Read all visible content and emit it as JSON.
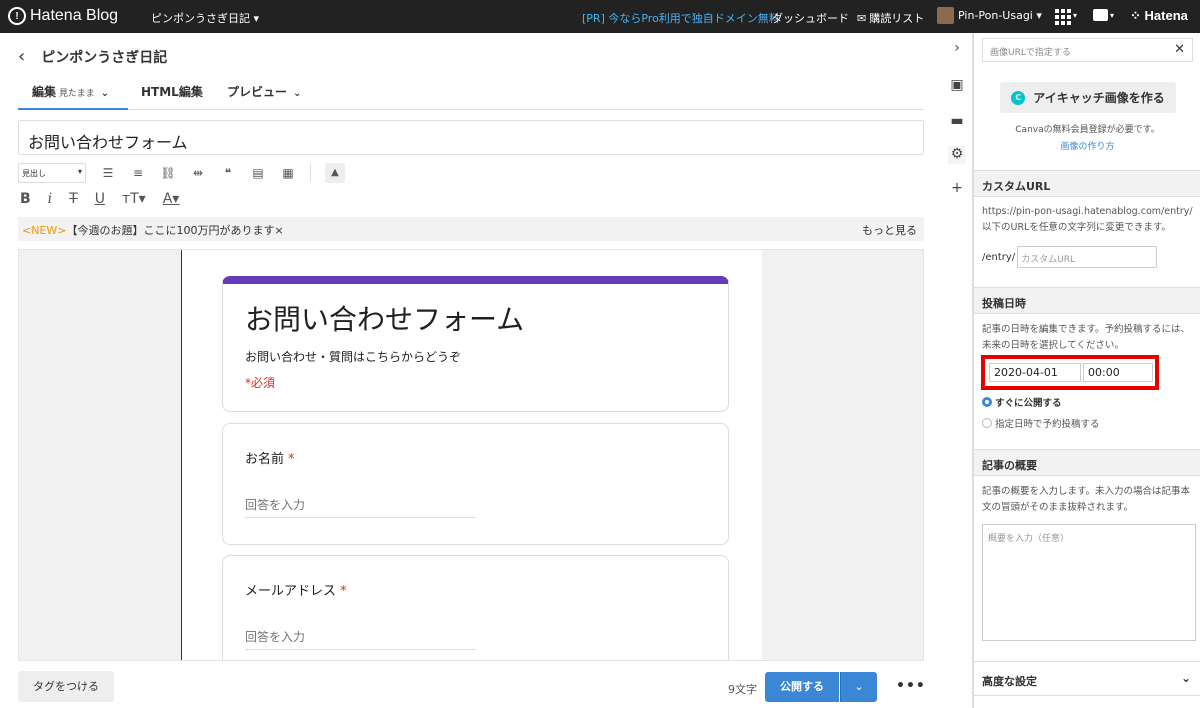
{
  "topbar": {
    "logo": "Hatena Blog",
    "blog_selector": "ピンポンうさぎ日記 ▾",
    "promo": "[PR] 今ならPro利用で独自ドメイン無料",
    "dashboard": "ダッシュボード",
    "subscriptions": "購読リスト",
    "user": "Pin-Pon-Usagi ▾",
    "hatena": "Hatena"
  },
  "editor": {
    "blog_title": "ピンポンうさぎ日記",
    "tabs": {
      "edit": "編集",
      "edit_mode": "見たまま",
      "html": "HTML編集",
      "preview": "プレビュー"
    },
    "entry_title": "お問い合わせフォーム",
    "format_select": "見出し",
    "new_banner": {
      "badge": "<NEW>",
      "text": "【今週のお題】ここに100万円があります",
      "close": "×",
      "more": "もっと見る"
    }
  },
  "form": {
    "title": "お問い合わせフォーム",
    "description": "お問い合わせ・質問はこちらからどうぞ",
    "required_note": "*必須",
    "questions": [
      {
        "label": "お名前",
        "star": "*",
        "placeholder": "回答を入力"
      },
      {
        "label": "メールアドレス",
        "star": "*",
        "placeholder": "回答を入力"
      }
    ]
  },
  "footer": {
    "tag_button": "タグをつける",
    "char_count": "9文字",
    "publish": "公開する",
    "more": "•••"
  },
  "panel": {
    "image_url_placeholder": "画像URLで指定する",
    "canva_button": "アイキャッチ画像を作る",
    "canva_note": "Canvaの無料会員登録が必要です。",
    "canva_link": "画像の作り方",
    "custom_url": {
      "heading": "カスタムURL",
      "desc": "https://pin-pon-usagi.hatenablog.com/entry/以下のURLを任意の文字列に変更できます。",
      "prefix": "/entry/",
      "placeholder": "カスタムURL"
    },
    "post_date": {
      "heading": "投稿日時",
      "desc": "記事の日時を編集できます。予約投稿するには、未来の日時を選択してください。",
      "date": "2020-04-01",
      "time": "00:00",
      "option_now": "すぐに公開する",
      "option_schedule": "指定日時で予約投稿する"
    },
    "summary": {
      "heading": "記事の概要",
      "desc": "記事の概要を入力します。未入力の場合は記事本文の冒頭がそのまま抜粋されます。",
      "placeholder": "概要を入力（任意）"
    },
    "advanced": "高度な設定"
  },
  "colors": {
    "topbar": "#222222",
    "accent": "#3b87d6",
    "form_header": "#673ab7",
    "highlight": "#e60000",
    "promo": "#49b1f5",
    "new_badge": "#f39800"
  }
}
